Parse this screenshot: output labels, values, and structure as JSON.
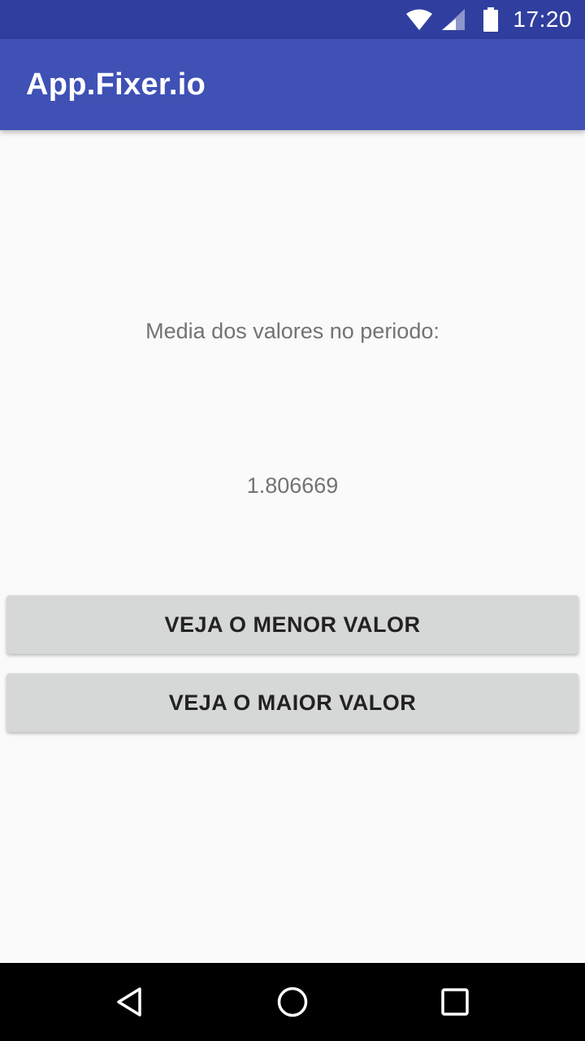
{
  "status_bar": {
    "time": "17:20",
    "icons": [
      "wifi-icon",
      "cell-signal-icon",
      "battery-icon"
    ]
  },
  "app_bar": {
    "title": "App.Fixer.io",
    "color": "#3f51b5",
    "status_color": "#303f9f"
  },
  "main": {
    "label": "Media dos valores no periodo:",
    "value": "1.806669",
    "buttons": {
      "min_label": "VEJA O MENOR VALOR",
      "max_label": "VEJA O MAIOR VALOR"
    }
  },
  "nav_bar": {
    "icons": [
      "back-icon",
      "home-icon",
      "recents-icon"
    ]
  }
}
